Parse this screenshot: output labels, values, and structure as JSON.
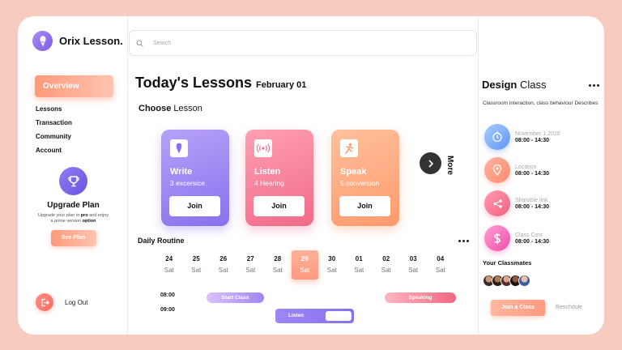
{
  "app": {
    "logo_text": "Orix Lesson.",
    "logo_icon": "ice-cream-icon"
  },
  "sidebar": {
    "overview_label": "Overview",
    "items": [
      {
        "label": "Lessons"
      },
      {
        "label": "Transaction"
      },
      {
        "label": "Community"
      },
      {
        "label": "Account"
      }
    ],
    "upgrade": {
      "title": "Upgrade Plan",
      "desc_part1": "Upgrade your  plan to ",
      "desc_pro": "pro",
      "desc_part2": " and enjoy",
      "desc_part3": "a prime version ",
      "desc_option": "option",
      "button": "See Plan"
    },
    "logout_label": "Log  Out"
  },
  "search": {
    "placeholder": "Search"
  },
  "main": {
    "title": "Today's Lessons",
    "date": "February 01",
    "choose_bold": "Choose",
    "choose_rest": " Lesson",
    "cards": [
      {
        "name": "Write",
        "sub": "3 excersice",
        "join": "Join",
        "icon": "ice-cream-icon"
      },
      {
        "name": "Listen",
        "sub": "4 Hearing",
        "join": "Join",
        "icon": "sound-wave-icon"
      },
      {
        "name": "Speak",
        "sub": "5 conversion",
        "join": "Join",
        "icon": "speaker-person-icon"
      }
    ],
    "more_label": "More",
    "routine": {
      "title": "Daily Routine",
      "days": [
        {
          "num": "24",
          "dw": "Sat"
        },
        {
          "num": "25",
          "dw": "Sat"
        },
        {
          "num": "26",
          "dw": "Sat"
        },
        {
          "num": "27",
          "dw": "Sat"
        },
        {
          "num": "28",
          "dw": "Sat"
        },
        {
          "num": "29",
          "dw": "Sat"
        },
        {
          "num": "30",
          "dw": "Sat"
        },
        {
          "num": "01",
          "dw": "Sat"
        },
        {
          "num": "02",
          "dw": "Sat"
        },
        {
          "num": "03",
          "dw": "Sat"
        },
        {
          "num": "04",
          "dw": "Sat"
        }
      ],
      "active_day": "29",
      "times": [
        "08:00",
        "09:00"
      ],
      "events": {
        "start": "Start Class",
        "speaking": "Speaking",
        "listen": "Listen"
      }
    }
  },
  "right": {
    "title_bold": "Design",
    "title_rest": " Class",
    "desc": "Classroom interaction, class behaviour Describes",
    "info": [
      {
        "label": "November 1,2020",
        "value": "08:00 - 14:30",
        "icon": "clock-icon"
      },
      {
        "label": "Location",
        "value": "08:00 - 14:30",
        "icon": "location-pin-icon"
      },
      {
        "label": "Sharable link",
        "value": "08:00 - 14:30",
        "icon": "share-icon"
      },
      {
        "label": "Class Cost",
        "value": "08:00 - 14:30",
        "icon": "dollar-icon"
      }
    ],
    "classmates_title": "Your Classmates",
    "join_label": "Join a Class",
    "reschedule_label": "Reschdule"
  },
  "colors": {
    "background": "#f7cbbd",
    "accent_peach": "#ff9a80",
    "purple": "#8a70ee",
    "pink": "#f06b8a",
    "orange": "#ff9a6d"
  }
}
